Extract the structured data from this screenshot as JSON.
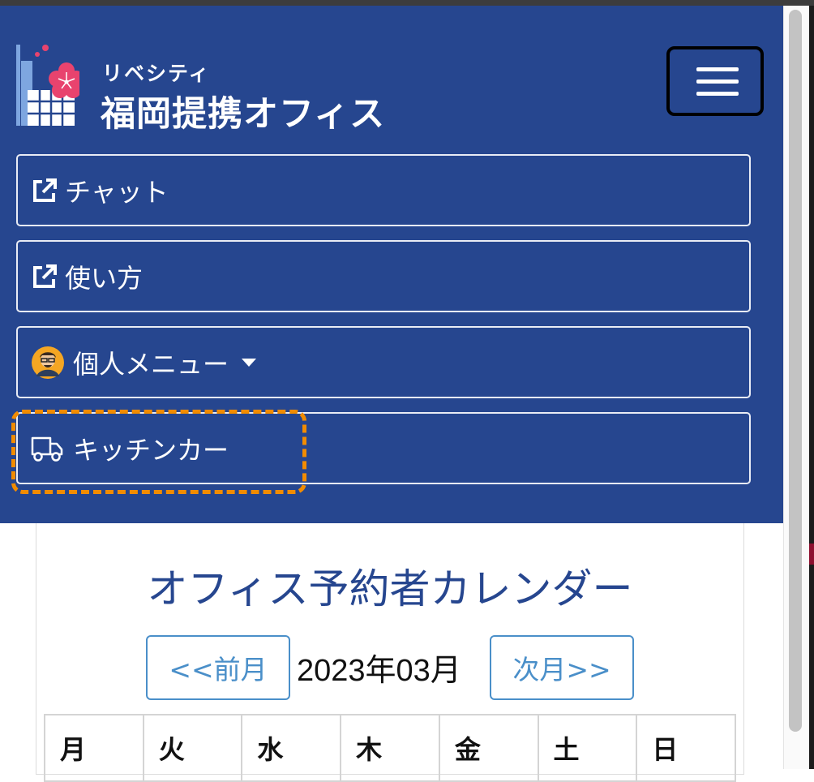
{
  "brand": {
    "subtitle": "リベシティ",
    "title": "福岡提携オフィス"
  },
  "menu_toggle": {
    "icon": "hamburger-menu-icon"
  },
  "nav": {
    "items": [
      {
        "label": "チャット",
        "icon": "external-link-icon"
      },
      {
        "label": "使い方",
        "icon": "external-link-icon"
      },
      {
        "label": "個人メニュー",
        "icon": "avatar",
        "dropdown_icon": "caret-down-icon"
      },
      {
        "label": "キッチンカー",
        "icon": "truck-icon"
      }
    ]
  },
  "calendar": {
    "title": "オフィス予約者カレンダー",
    "prev_label": "<<前月",
    "month": "2023年03月",
    "next_label": "次月>>",
    "weekdays": [
      "月",
      "火",
      "水",
      "木",
      "金",
      "土",
      "日"
    ]
  },
  "colors": {
    "header_bg": "#26468f",
    "accent_blue": "#4a8fc9",
    "highlight_orange": "#f28c00",
    "logo_flower": "#e8436e"
  }
}
